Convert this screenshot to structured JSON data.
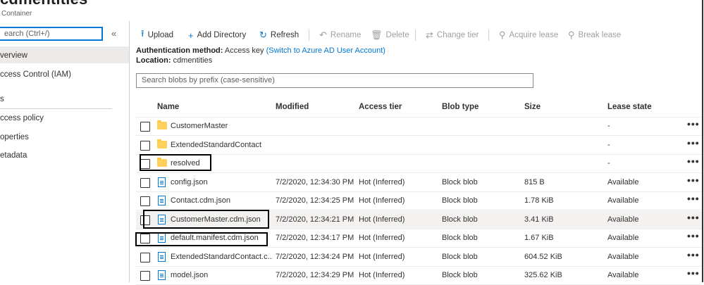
{
  "header": {
    "title": "cdmentities",
    "subtitle": "Container"
  },
  "sidebar": {
    "search_placeholder": "earch (Ctrl+/)",
    "collapse_glyph": "«",
    "items": [
      {
        "label": "verview"
      },
      {
        "label": "ccess Control (IAM)"
      },
      {
        "label": "s"
      },
      {
        "label": "ccess policy"
      },
      {
        "label": "operties"
      },
      {
        "label": "etadata"
      }
    ]
  },
  "toolbar": {
    "upload": "Upload",
    "add_directory": "Add Directory",
    "refresh": "Refresh",
    "rename": "Rename",
    "delete": "Delete",
    "change_tier": "Change tier",
    "acquire_lease": "Acquire lease",
    "break_lease": "Break lease"
  },
  "info": {
    "auth_label": "Authentication method:",
    "auth_value": "Access key",
    "auth_link": "(Switch to Azure AD User Account)",
    "location_label": "Location:",
    "location_value": "cdmentities"
  },
  "blob_search_placeholder": "Search blobs by prefix (case-sensitive)",
  "columns": {
    "name": "Name",
    "modified": "Modified",
    "access_tier": "Access tier",
    "blob_type": "Blob type",
    "size": "Size",
    "lease_state": "Lease state"
  },
  "rows": [
    {
      "name": "CustomerMaster",
      "modified": "",
      "tier": "",
      "type": "",
      "size": "",
      "lease": "-"
    },
    {
      "name": "ExtendedStandardContact",
      "modified": "",
      "tier": "",
      "type": "",
      "size": "",
      "lease": "-"
    },
    {
      "name": "resolved",
      "modified": "",
      "tier": "",
      "type": "",
      "size": "",
      "lease": "-"
    },
    {
      "name": "config.json",
      "modified": "7/2/2020, 12:34:30 PM",
      "tier": "Hot (Inferred)",
      "type": "Block blob",
      "size": "815 B",
      "lease": "Available"
    },
    {
      "name": "Contact.cdm.json",
      "modified": "7/2/2020, 12:34:25 PM",
      "tier": "Hot (Inferred)",
      "type": "Block blob",
      "size": "1.78 KiB",
      "lease": "Available"
    },
    {
      "name": "CustomerMaster.cdm.json",
      "modified": "7/2/2020, 12:34:21 PM",
      "tier": "Hot (Inferred)",
      "type": "Block blob",
      "size": "3.41 KiB",
      "lease": "Available"
    },
    {
      "name": "default.manifest.cdm.json",
      "modified": "7/2/2020, 12:34:17 PM",
      "tier": "Hot (Inferred)",
      "type": "Block blob",
      "size": "1.67 KiB",
      "lease": "Available"
    },
    {
      "name": "ExtendedStandardContact.c...",
      "modified": "7/2/2020, 12:34:24 PM",
      "tier": "Hot (Inferred)",
      "type": "Block blob",
      "size": "604.52 KiB",
      "lease": "Available"
    },
    {
      "name": "model.json",
      "modified": "7/2/2020, 12:34:29 PM",
      "tier": "Hot (Inferred)",
      "type": "Block blob",
      "size": "325.62 KiB",
      "lease": "Available"
    }
  ],
  "row_more_glyph": "•••",
  "icons": {
    "upload": "upload-icon",
    "add": "plus-icon",
    "refresh": "refresh-icon",
    "rename": "rename-icon",
    "delete": "trash-icon",
    "change_tier": "swap-icon",
    "acquire_lease": "lease-icon",
    "break_lease": "break-lease-icon",
    "folder": "folder-icon",
    "file": "file-icon"
  },
  "colors": {
    "accent": "#0078d4",
    "folder": "#ffd15c",
    "highlight_box": "#000000"
  }
}
